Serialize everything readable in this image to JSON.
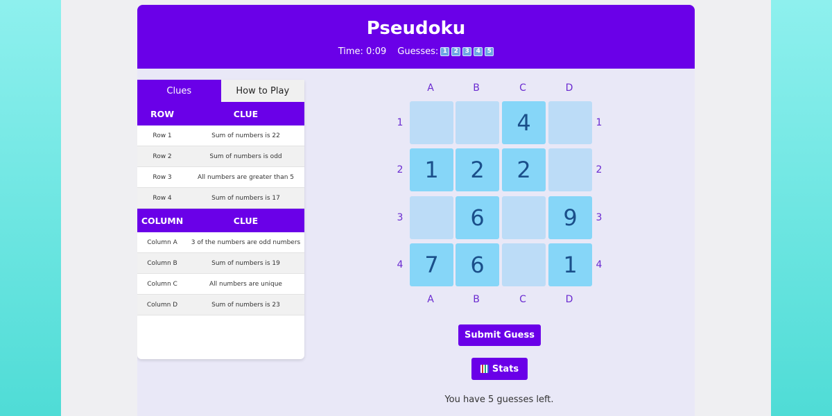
{
  "header": {
    "title": "Pseudoku",
    "time_label": "Time: 0:09",
    "guesses_label": "Guesses:",
    "guess_boxes": [
      "1",
      "2",
      "3",
      "4",
      "5"
    ]
  },
  "tabs": [
    {
      "label": "Clues",
      "active": true
    },
    {
      "label": "How to Play",
      "active": false
    }
  ],
  "row_clues": {
    "header": [
      "ROW",
      "CLUE"
    ],
    "items": [
      {
        "name": "Row 1",
        "clue": "Sum of numbers is 22"
      },
      {
        "name": "Row 2",
        "clue": "Sum of numbers is odd"
      },
      {
        "name": "Row 3",
        "clue": "All numbers are greater than 5"
      },
      {
        "name": "Row 4",
        "clue": "Sum of numbers is 17"
      }
    ]
  },
  "column_clues": {
    "header": [
      "COLUMN",
      "CLUE"
    ],
    "items": [
      {
        "name": "Column A",
        "clue": "3 of the numbers are odd numbers"
      },
      {
        "name": "Column B",
        "clue": "Sum of numbers is 19"
      },
      {
        "name": "Column C",
        "clue": "All numbers are unique"
      },
      {
        "name": "Column D",
        "clue": "Sum of numbers is 23"
      }
    ]
  },
  "grid": {
    "columns": [
      "A",
      "B",
      "C",
      "D"
    ],
    "rows": [
      "1",
      "2",
      "3",
      "4"
    ],
    "cells": [
      [
        "",
        "",
        "4",
        ""
      ],
      [
        "1",
        "2",
        "2",
        ""
      ],
      [
        "",
        "6",
        "",
        "9"
      ],
      [
        "7",
        "6",
        "",
        "1"
      ]
    ]
  },
  "actions": {
    "submit_label": "Submit Guess",
    "stats_label": "Stats"
  },
  "status": "You have 5 guesses left.",
  "colors": {
    "accent": "#6a00e8",
    "cell_empty": "#bcdcf7",
    "cell_filled": "#86d6f8",
    "digit": "#1a4f8a"
  }
}
